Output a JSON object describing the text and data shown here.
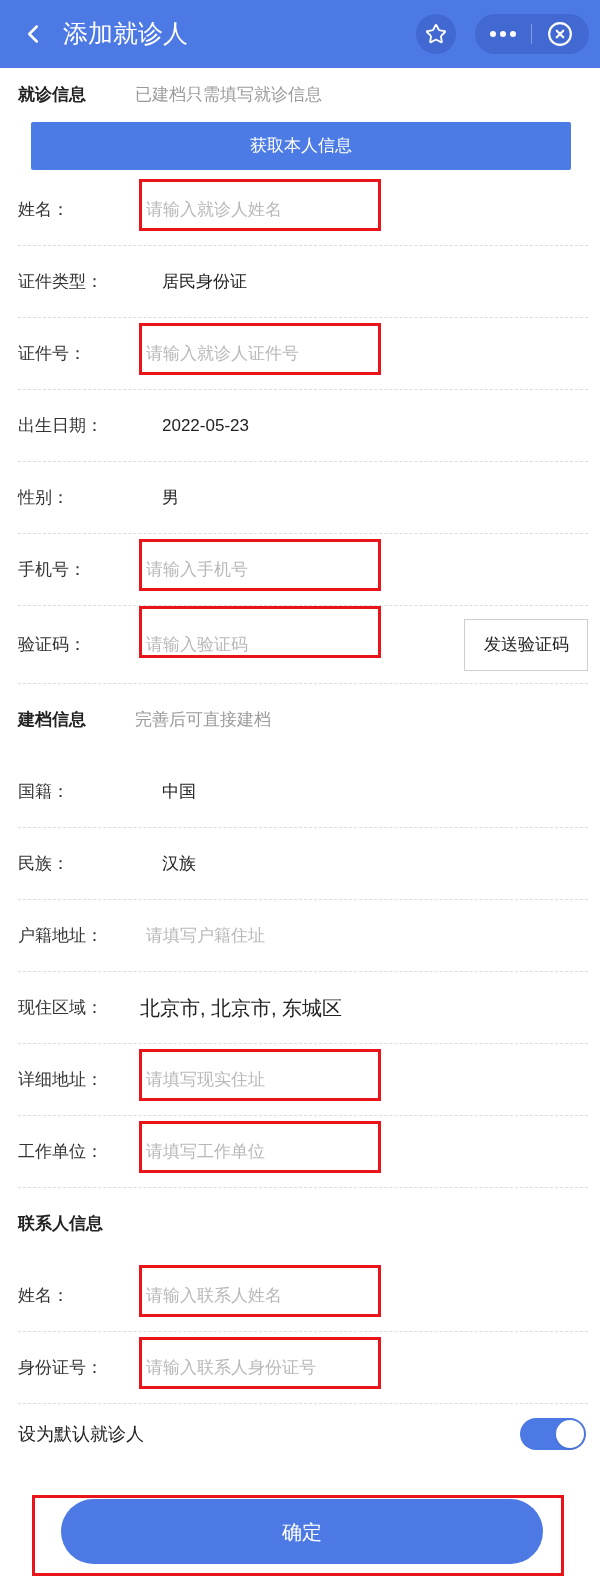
{
  "header": {
    "title": "添加就诊人"
  },
  "sections": [
    {
      "title": "就诊信息",
      "subtitle": "已建档只需填写就诊信息",
      "action": "获取本人信息",
      "rows": [
        {
          "kind": "input",
          "label": "姓名：",
          "placeholder": "请输入就诊人姓名",
          "highlighted": true
        },
        {
          "kind": "picker",
          "label": "证件类型：",
          "value": "居民身份证",
          "highlighted": false
        },
        {
          "kind": "input",
          "label": "证件号：",
          "placeholder": "请输入就诊人证件号",
          "highlighted": true
        },
        {
          "kind": "picker",
          "label": "出生日期：",
          "value": "2022-05-23",
          "highlighted": false
        },
        {
          "kind": "picker",
          "label": "性别：",
          "value": "男",
          "highlighted": false
        },
        {
          "kind": "input",
          "label": "手机号：",
          "placeholder": "请输入手机号",
          "highlighted": true
        },
        {
          "kind": "code",
          "label": "验证码：",
          "placeholder": "请输入验证码",
          "button": "发送验证码",
          "highlighted": true
        }
      ]
    },
    {
      "title": "建档信息",
      "subtitle": "完善后可直接建档",
      "rows": [
        {
          "kind": "picker",
          "label": "国籍：",
          "value": "中国",
          "highlighted": false
        },
        {
          "kind": "picker",
          "label": "民族：",
          "value": "汉族",
          "highlighted": false
        },
        {
          "kind": "input",
          "label": "户籍地址：",
          "placeholder": "请填写户籍住址",
          "highlighted": false
        },
        {
          "kind": "region",
          "label": "现住区域：",
          "value": "北京市, 北京市, 东城区",
          "highlighted": false
        },
        {
          "kind": "input",
          "label": "详细地址：",
          "placeholder": "请填写现实住址",
          "highlighted": true
        },
        {
          "kind": "input",
          "label": "工作单位：",
          "placeholder": "请填写工作单位",
          "highlighted": true
        }
      ]
    },
    {
      "title": "联系人信息",
      "rows": [
        {
          "kind": "input",
          "label": "姓名：",
          "placeholder": "请输入联系人姓名",
          "highlighted": true
        },
        {
          "kind": "input",
          "label": "身份证号：",
          "placeholder": "请输入联系人身份证号",
          "highlighted": true
        }
      ]
    }
  ],
  "default_patient": {
    "label": "设为默认就诊人",
    "on": true
  },
  "confirm": {
    "label": "确定",
    "highlighted": true
  }
}
